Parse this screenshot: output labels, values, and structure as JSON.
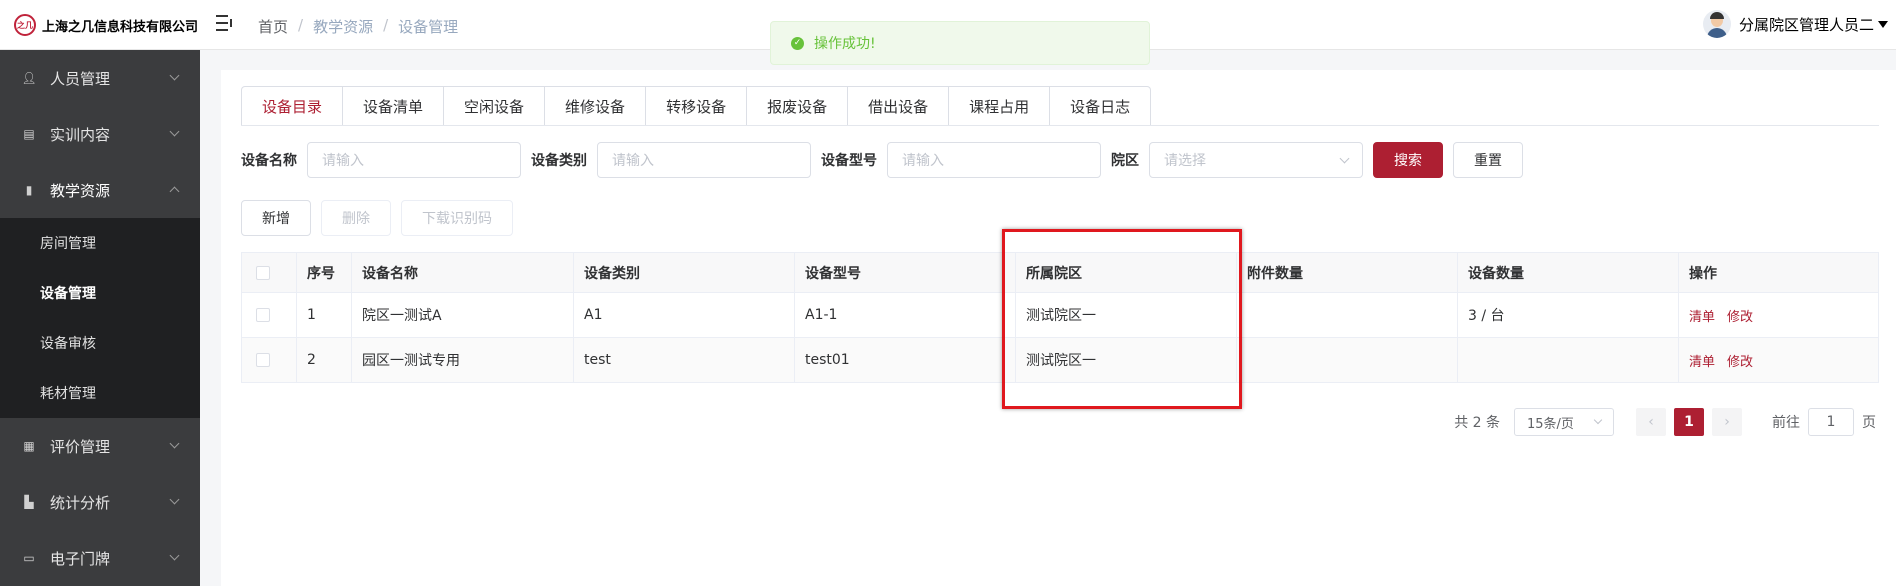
{
  "brand": {
    "logo_mark": "之几",
    "name": "上海之几信息科技有限公司"
  },
  "breadcrumb": [
    "首页",
    "教学资源",
    "设备管理"
  ],
  "user": {
    "name": "分属院区管理人员二"
  },
  "toast": {
    "text": "操作成功!"
  },
  "sidebar": {
    "items": [
      {
        "label": "人员管理",
        "icon": "user-icon"
      },
      {
        "label": "实训内容",
        "icon": "doc-icon"
      },
      {
        "label": "教学资源",
        "icon": "book-icon"
      },
      {
        "label": "评价管理",
        "icon": "calendar-icon"
      },
      {
        "label": "统计分析",
        "icon": "bar-chart-icon"
      },
      {
        "label": "电子门牌",
        "icon": "monitor-icon"
      }
    ],
    "submenu": [
      "房间管理",
      "设备管理",
      "设备审核",
      "耗材管理"
    ]
  },
  "tabs": [
    "设备目录",
    "设备清单",
    "空闲设备",
    "维修设备",
    "转移设备",
    "报废设备",
    "借出设备",
    "课程占用",
    "设备日志"
  ],
  "filters": {
    "name_label": "设备名称",
    "name_placeholder": "请输入",
    "type_label": "设备类别",
    "type_placeholder": "请输入",
    "model_label": "设备型号",
    "model_placeholder": "请输入",
    "campus_label": "院区",
    "campus_placeholder": "请选择",
    "search": "搜索",
    "reset": "重置"
  },
  "actions": {
    "add": "新增",
    "delete": "删除",
    "download": "下载识别码"
  },
  "table": {
    "headers": [
      "序号",
      "设备名称",
      "设备类别",
      "设备型号",
      "所属院区",
      "附件数量",
      "设备数量",
      "操作"
    ],
    "rows": [
      {
        "index": "1",
        "name": "院区一测试A",
        "type": "A1",
        "model": "A1-1",
        "campus": "测试院区一",
        "attachments": "",
        "count": "3 / 台",
        "op1": "清单",
        "op2": "修改"
      },
      {
        "index": "2",
        "name": "园区一测试专用",
        "type": "test",
        "model": "test01",
        "campus": "测试院区一",
        "attachments": "",
        "count": "",
        "op1": "清单",
        "op2": "修改"
      }
    ]
  },
  "pagination": {
    "total": "共 2 条",
    "page_size": "15条/页",
    "current": "1",
    "goto_prefix": "前往",
    "goto_value": "1",
    "goto_suffix": "页"
  },
  "colors": {
    "primary": "#ad1f32",
    "sidebar": "#3b3c3e",
    "submenu": "#1f2022",
    "highlight": "#e0181e",
    "success": "#67c23a"
  }
}
